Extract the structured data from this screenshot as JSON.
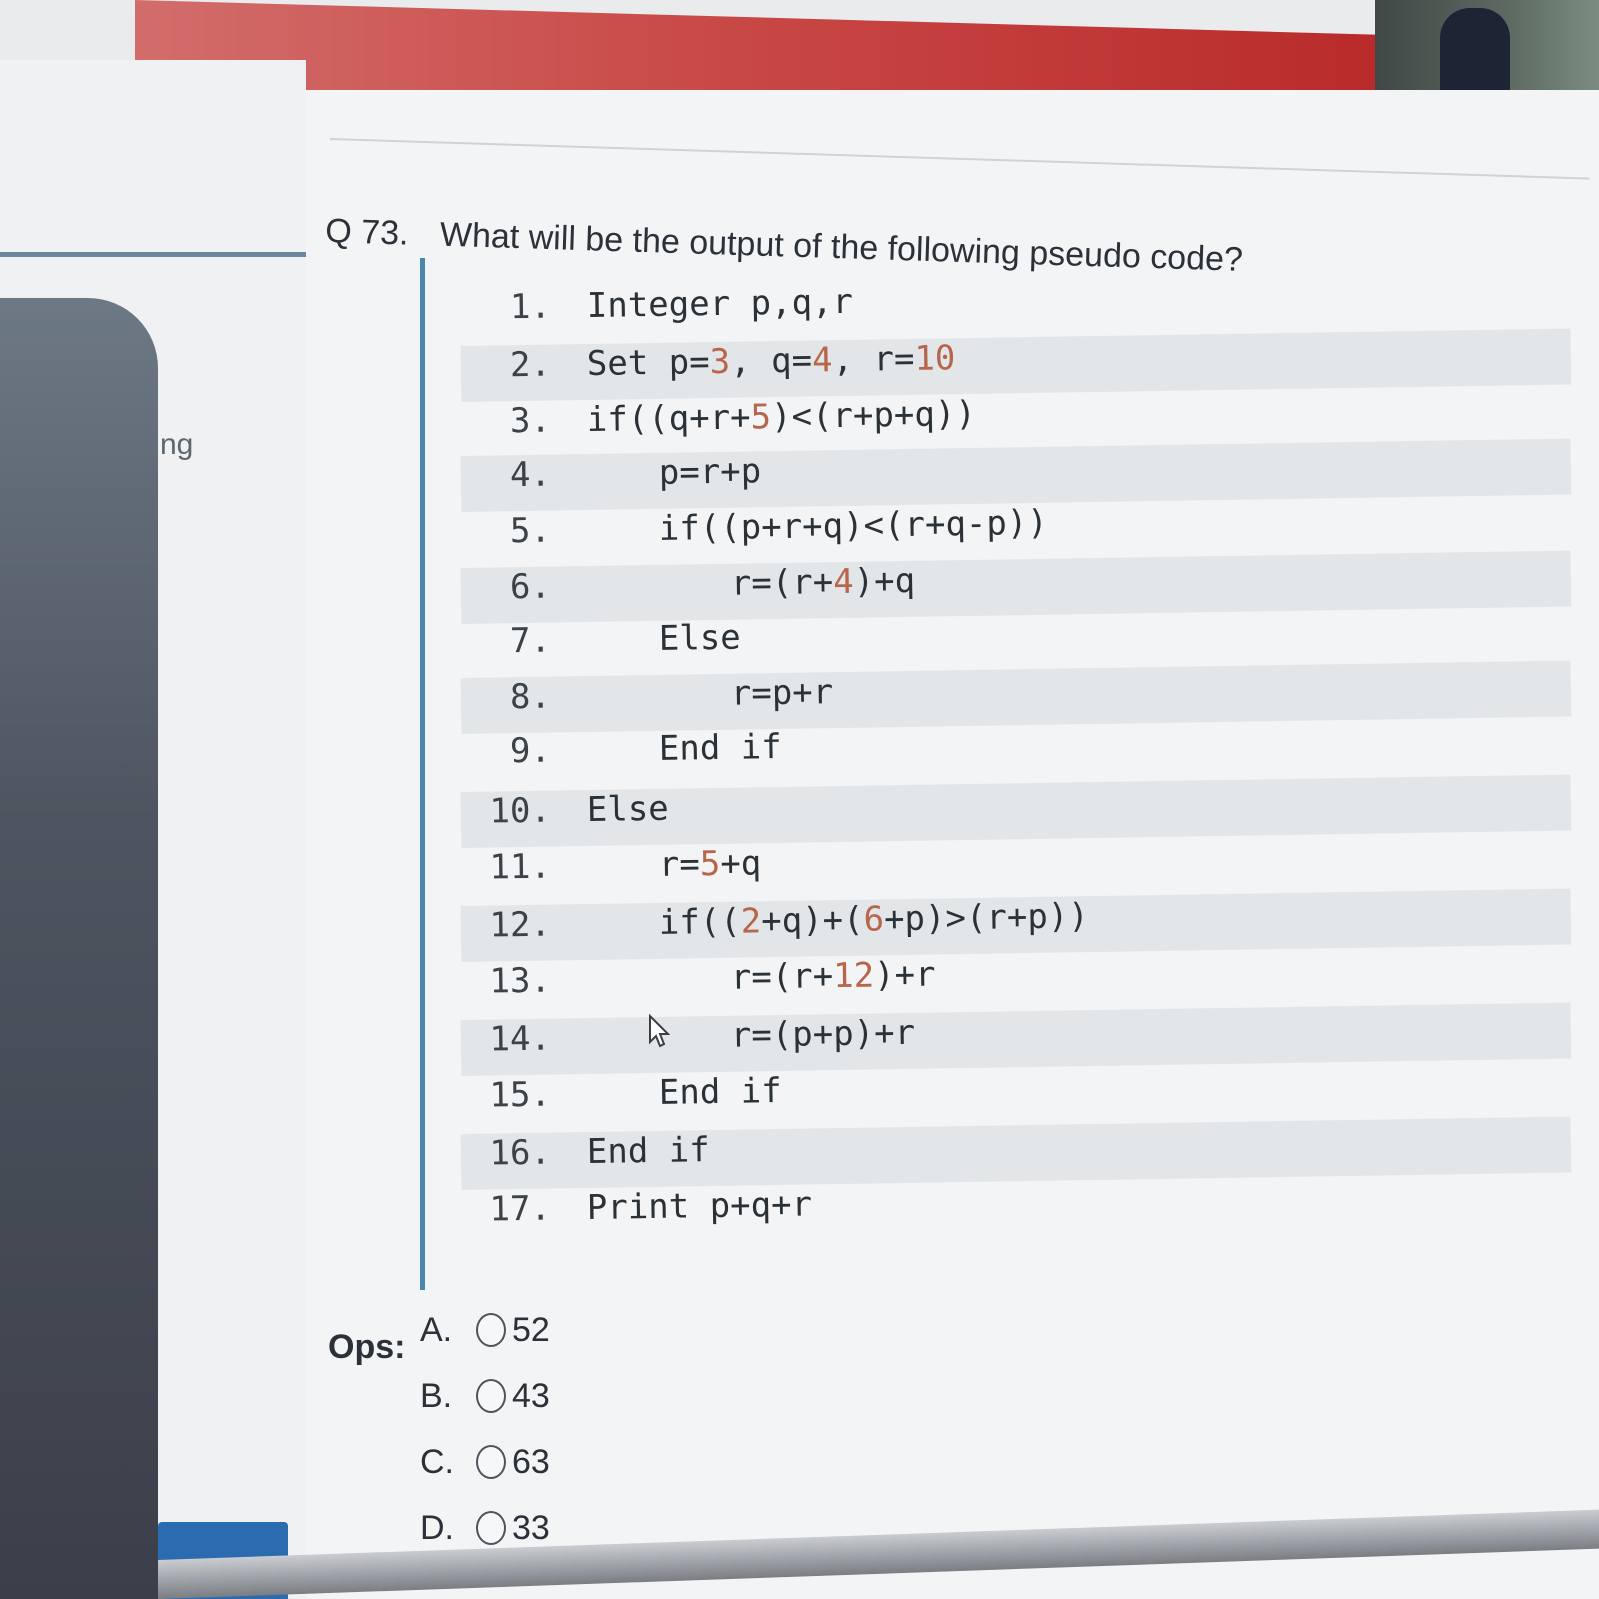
{
  "sidebar": {
    "label": "ng"
  },
  "question": {
    "number": "Q 73.",
    "text": "What will be the output of the following pseudo code?"
  },
  "code_lines": [
    {
      "num": "1.",
      "code": "Integer p,q,r"
    },
    {
      "num": "2.",
      "code": "Set p=3, q=4, r=10"
    },
    {
      "num": "3.",
      "code": "if((q+r+5)<(r+p+q))"
    },
    {
      "num": "4.",
      "code": "p=r+p"
    },
    {
      "num": "5.",
      "code": "if((p+r+q)<(r+q-p))"
    },
    {
      "num": "6.",
      "code": "r=(r+4)+q"
    },
    {
      "num": "7.",
      "code": "Else"
    },
    {
      "num": "8.",
      "code": "r=p+r"
    },
    {
      "num": "9.",
      "code": "End if"
    },
    {
      "num": "10.",
      "code": "Else"
    },
    {
      "num": "11.",
      "code": "r=5+q"
    },
    {
      "num": "12.",
      "code": "if((2+q)+(6+p)>(r+p))"
    },
    {
      "num": "13.",
      "code": "r=(r+12)+r"
    },
    {
      "num": "14.",
      "code": "r=(p+p)+r"
    },
    {
      "num": "15.",
      "code": "End if"
    },
    {
      "num": "16.",
      "code": "End if"
    },
    {
      "num": "17.",
      "code": "Print p+q+r"
    }
  ],
  "options": {
    "label": "Ops:",
    "items": [
      {
        "letter": "A.",
        "value": "52"
      },
      {
        "letter": "B.",
        "value": "43"
      },
      {
        "letter": "C.",
        "value": "63"
      },
      {
        "letter": "D.",
        "value": "33"
      }
    ]
  },
  "colors": {
    "banner": "#c94a47",
    "code_border": "#4b87ad",
    "number_literal": "#b8664b"
  }
}
